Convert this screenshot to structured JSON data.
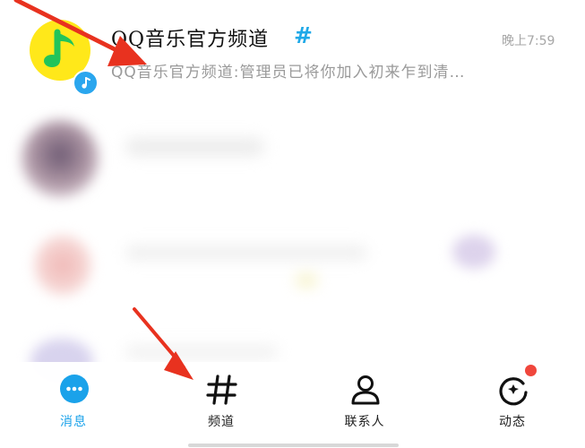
{
  "conversation": {
    "title": "QQ音乐官方频道",
    "channel_mark": "#",
    "time": "晚上7:59",
    "preview": "QQ音乐官方频道:管理员已将你加入初来乍到清…",
    "avatar_icon": "music-note-icon",
    "badge_icon": "channel-music-badge-icon"
  },
  "bottom_nav": {
    "items": [
      {
        "label": "消息",
        "icon": "chat-bubble-icon",
        "active": true
      },
      {
        "label": "频道",
        "icon": "hash-icon",
        "active": false
      },
      {
        "label": "联系人",
        "icon": "person-icon",
        "active": false
      },
      {
        "label": "动态",
        "icon": "star-refresh-icon",
        "active": false
      }
    ]
  },
  "colors": {
    "accent": "#1aa2ea",
    "avatar_bg": "#ffe81a",
    "avatar_note": "#21c45a",
    "annotation_arrow": "#e8321f",
    "notification_dot": "#f0463c"
  }
}
